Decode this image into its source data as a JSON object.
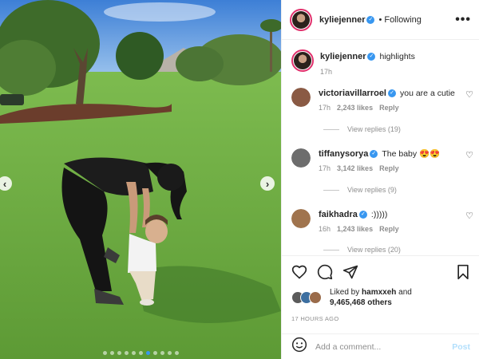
{
  "post": {
    "author": "kyliejenner",
    "follow_status": "Following",
    "separator": "•",
    "more_label": "•••",
    "verified_glyph": "✓",
    "caption": {
      "username": "kyliejenner",
      "text": "highlights",
      "time": "17h"
    }
  },
  "comments": [
    {
      "username": "victoriavillarroel",
      "text": "you are a cutie",
      "time": "17h",
      "likes": "2,243 likes",
      "reply": "Reply",
      "view_replies": "View replies (19)",
      "avatar_color": "#8a5a44"
    },
    {
      "username": "tiffanysorya",
      "text": "The baby 😍😍",
      "time": "17h",
      "likes": "3,142 likes",
      "reply": "Reply",
      "view_replies": "View replies (9)",
      "avatar_color": "#6d6d6d"
    },
    {
      "username": "faikhadra",
      "text": ":)))))",
      "time": "16h",
      "likes": "1,243 likes",
      "reply": "Reply",
      "view_replies": "View replies (20)",
      "avatar_color": "#a0744e"
    }
  ],
  "likes": {
    "prefix": "Liked by",
    "user": "hamxxeh",
    "joiner": "and",
    "count": "9,465,468 others"
  },
  "timestamp": "17 HOURS AGO",
  "add_comment": {
    "placeholder": "Add a comment...",
    "post_label": "Post"
  },
  "carousel": {
    "prev": "‹",
    "next": "›",
    "slide_count": 11,
    "active_index": 6
  },
  "icons": {
    "heart": "heart-icon",
    "comment": "comment-icon",
    "share": "share-icon",
    "save": "bookmark-icon",
    "emoji": "emoji-icon"
  },
  "colors": {
    "verified": "#3897f0",
    "muted": "#8e8e8e",
    "post_disabled": "#b2dffc",
    "grass": "#6aa842"
  }
}
